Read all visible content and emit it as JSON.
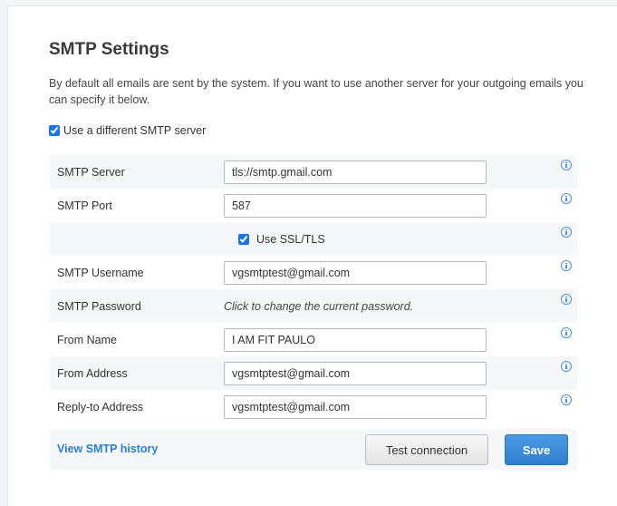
{
  "page": {
    "title": "SMTP Settings",
    "description": "By default all emails are sent by the system. If you want to use another server for your outgoing emails you can specify it below."
  },
  "use_custom_smtp": {
    "label": "Use a different SMTP server",
    "checked": true
  },
  "form": {
    "smtp_server": {
      "label": "SMTP Server",
      "value": "tls://smtp.gmail.com"
    },
    "smtp_port": {
      "label": "SMTP Port",
      "value": "587"
    },
    "ssl": {
      "label": "Use SSL/TLS",
      "checked": true
    },
    "smtp_username": {
      "label": "SMTP Username",
      "value": "vgsmtptest@gmail.com"
    },
    "smtp_password": {
      "label": "SMTP Password",
      "link_text": "Click to change the current password."
    },
    "from_name": {
      "label": "From Name",
      "value": "I AM FIT PAULO"
    },
    "from_address": {
      "label": "From Address",
      "value": "vgsmtptest@gmail.com"
    },
    "reply_to": {
      "label": "Reply-to Address",
      "value": "vgsmtptest@gmail.com"
    }
  },
  "footer": {
    "history_link": "View SMTP history",
    "test_button": "Test connection",
    "save_button": "Save"
  },
  "colors": {
    "accent": "#2f7fcf",
    "link": "#2a7fd4",
    "info_icon": "#4a90d9"
  },
  "icons": {
    "info": "info-circle-icon"
  }
}
